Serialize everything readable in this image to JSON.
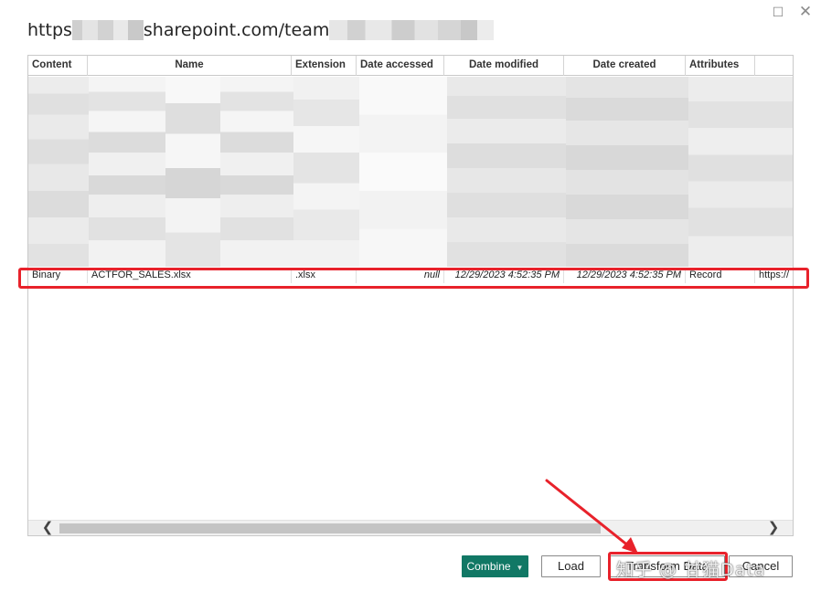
{
  "window": {
    "maximize_glyph": "☐",
    "close_glyph": "✕"
  },
  "header": {
    "title_prefix": "https",
    "title_middle": "sharepoint.com/team"
  },
  "table": {
    "columns": [
      "Content",
      "Name",
      "Extension",
      "Date accessed",
      "Date modified",
      "Date created",
      "Attributes",
      ""
    ],
    "highlighted_row": {
      "content": "Binary",
      "name": "ACTFOR_SALES.xlsx",
      "extension": ".xlsx",
      "date_accessed": "null",
      "date_modified": "12/29/2023 4:52:35 PM",
      "date_created": "12/29/2023 4:52:35 PM",
      "attributes": "Record",
      "folder_path": "https://"
    }
  },
  "scrollbar": {
    "left_arrow": "❮",
    "right_arrow": "❯"
  },
  "buttons": {
    "combine": "Combine",
    "combine_caret": "▼",
    "load": "Load",
    "transform": "Transform Data",
    "cancel": "Cancel"
  },
  "watermark": {
    "text": "知乎 @ 甘猫Data"
  },
  "colors": {
    "accent_green": "#117865",
    "highlight_red": "#e8222b"
  },
  "icons": [
    "maximize-icon",
    "close-icon",
    "scroll-left-icon",
    "scroll-right-icon",
    "dropdown-caret-icon",
    "annotation-arrow-icon"
  ]
}
